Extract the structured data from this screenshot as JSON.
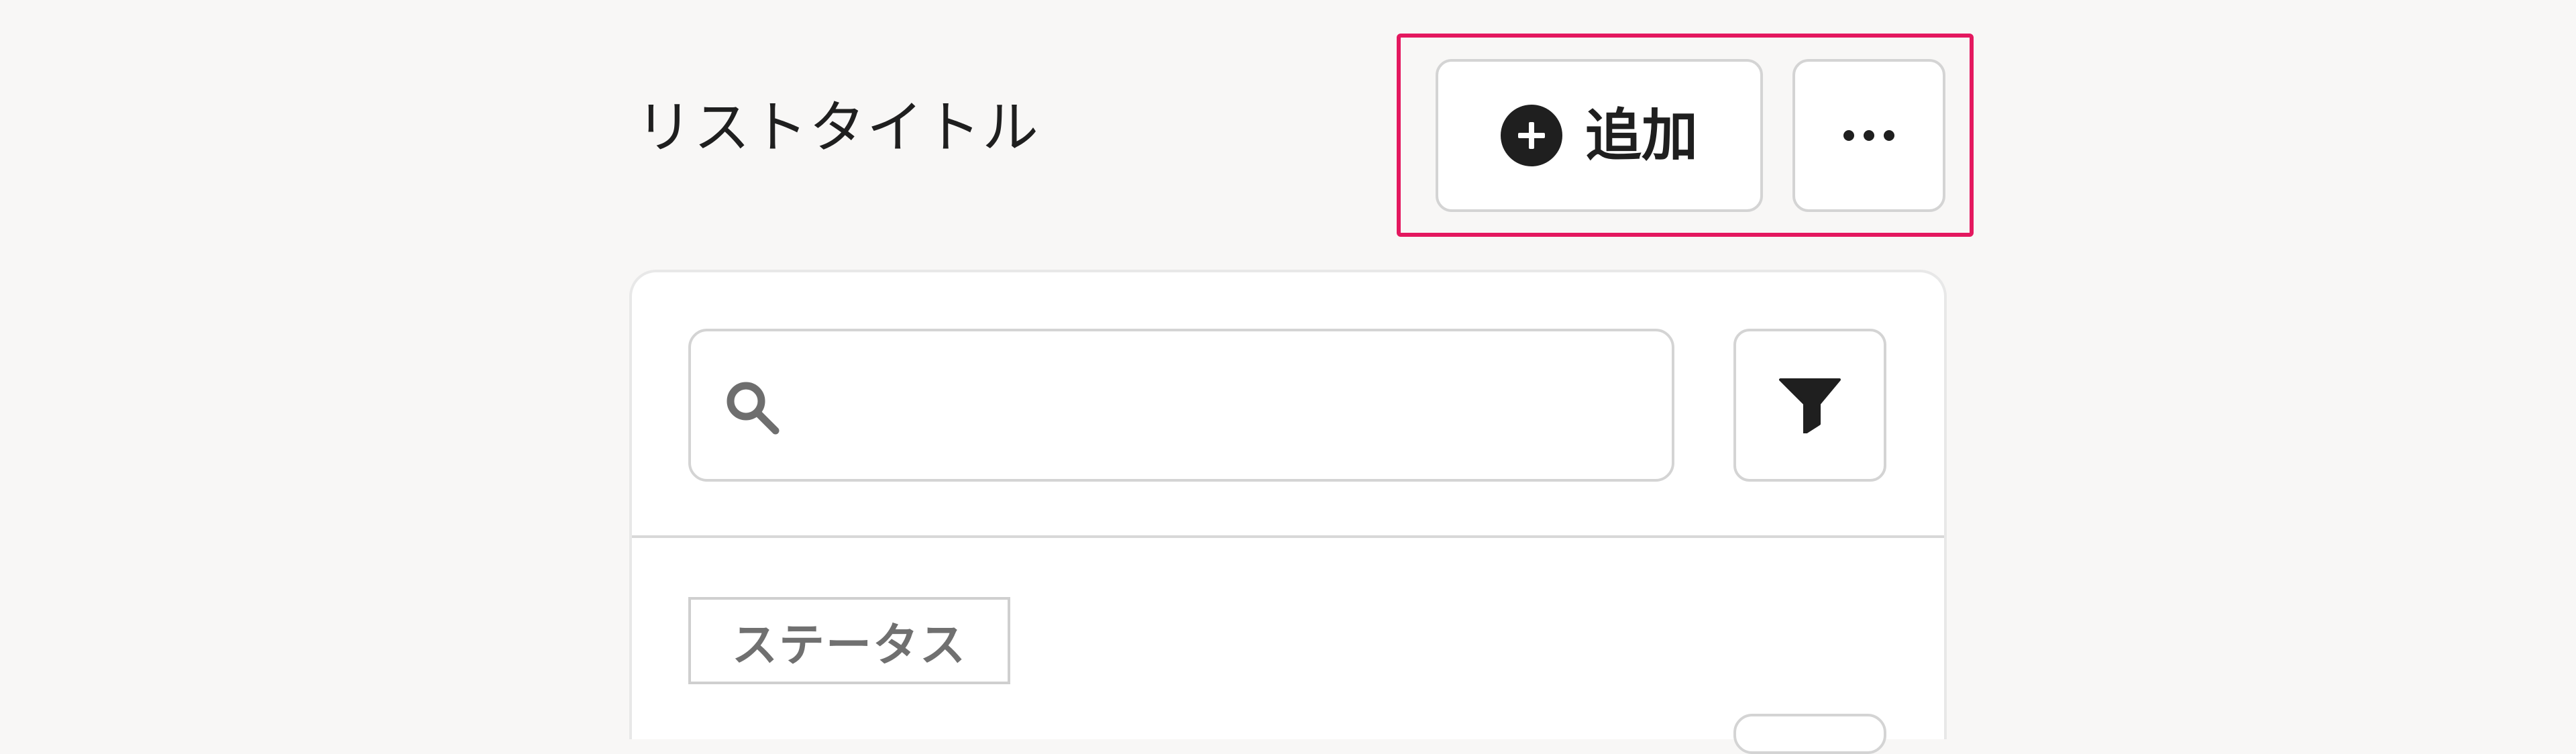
{
  "header": {
    "title": "リストタイトル",
    "add_label": "追加",
    "add_icon": "plus-circle-icon",
    "more_icon": "ellipsis-icon",
    "highlight_color": "#e4185f"
  },
  "search": {
    "placeholder": "",
    "value": "",
    "icon": "search-icon",
    "filter_icon": "filter-icon"
  },
  "filters": {
    "status_label": "ステータス"
  }
}
